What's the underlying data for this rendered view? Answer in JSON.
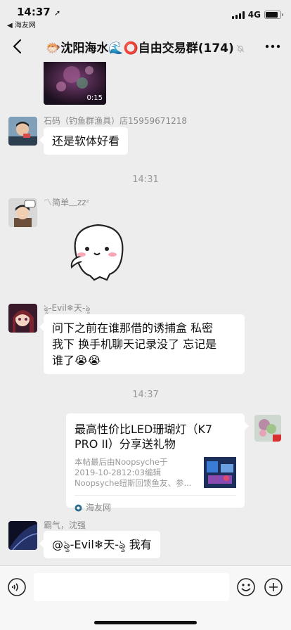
{
  "status": {
    "time": "14:37",
    "back_app": "◀ 海友网",
    "network": "4G",
    "battery_level": 0.85
  },
  "nav": {
    "title": "🐡沈阳海水🌊⭕自由交易群(174)"
  },
  "video": {
    "duration": "0:15"
  },
  "messages": [
    {
      "sender": "石码（钓鱼群渔具）店15959671218",
      "text": "还是软体好看"
    },
    {
      "sender": "〽简单﹏zzᶻ"
    },
    {
      "sender": "ৡ-Evil❄天-ৡ",
      "line1": "问下之前在谁那借的诱捕盒  私密",
      "line2": "我下  换手机聊天记录没了  忘记是",
      "line3": "谁了😭😭"
    },
    {
      "sender": "霸气，沈强",
      "text": "@ৡ-Evil❄天-ৡ 我有"
    }
  ],
  "time_separators": [
    "14:31",
    "14:37"
  ],
  "link_card": {
    "title": "最高性价比LED珊瑚灯（K7 PRO II）分享送礼物",
    "desc1": "本帖最后由Noopsyche于",
    "desc2": "2019-10-2812:03编辑",
    "desc3": "Noopsyche纽斯回馈鱼友、参...",
    "source": "海友网"
  }
}
